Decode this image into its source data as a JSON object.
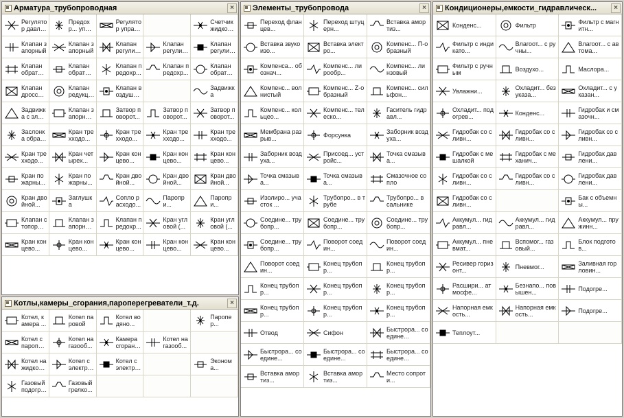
{
  "panels": {
    "armature": {
      "title": "Арматура_трубопроводная",
      "items": [
        "Регулятор давления",
        "Предохр... управл...",
        "Регулятор управл...",
        "",
        "Счетчик жидкост...",
        "Клапан запорный",
        "Клапан запорный",
        "Клапан регулир...",
        "Клапан регулир...",
        "Клапан регулир...",
        "Клапан обратны...",
        "Клапан обратны...",
        "Клапан предохр...",
        "Клапан предохр...",
        "Клапан обратны...",
        "Клапан дроссел...",
        "Клапан редукци...",
        "Клапан воздушн...",
        "",
        "Задвижка",
        "Задвижка с электро...",
        "Клапан запорны...",
        "Затвор поворот...",
        "Затвор поворот...",
        "Затвор поворот...",
        "Заслонка обратны...",
        "Кран трехходо...",
        "Кран трехходо...",
        "Кран трехходо...",
        "Кран трехходо...",
        "Кран трехходо...",
        "Кран четырех...",
        "Кран концево...",
        "Кран концево...",
        "Кран концево...",
        "Кран пожарны...",
        "Кран пожарны...",
        "Кран двойной...",
        "Кран двойной...",
        "Кран двойной...",
        "Кран двойной...",
        "Заглушка",
        "Сопло расходо...",
        "Паропри...",
        "Паропри...",
        "Клапан стопорный",
        "Клапан запорны...",
        "Клапан предохр...",
        "Кран угловой (...",
        "Кран угловой (...",
        "Кран концево...",
        "Кран концево...",
        "Кран концево...",
        "Кран концево...",
        "Кран концево..."
      ]
    },
    "boilers": {
      "title": "Котлы,камеры_сгорания,пароперегреватели_т.д.",
      "items": [
        "Котел, камера ...",
        "Котел паровой",
        "Котел водяно...",
        "",
        "Паропер...",
        "Котел с паропер...",
        "Котел на газооб...",
        "Камера сгорани...",
        "Котел на газооб...",
        "",
        "Котел на жидком...",
        "Котел с электро...",
        "Котел с электро...",
        "",
        "Эконома...",
        "Газовый подогре...",
        "Газовый грелко...",
        "",
        "",
        ""
      ]
    },
    "pipe": {
      "title": "Элементы_трубопровода",
      "items": [
        "Переход фланцев...",
        "Переход штуцерн...",
        "Вставка амортиз...",
        "Вставка звукоизо...",
        "Вставка электро...",
        "Компенс... П-образный",
        "Компенса... обознач...",
        "Компенс... лирообр...",
        "Компенс... линзовый",
        "Компенс... волнистый",
        "Компенс... Z-образный",
        "Компенс... сильфон...",
        "Компенс... кольцео...",
        "Компенс... телеско...",
        "Гаситель гидравл...",
        "Мембрана разрыв...",
        "Форсунка",
        "Заборник воздуха...",
        "Заборник воздуха...",
        "Присоед... устройс...",
        "Точка смазыва...",
        "Точка смазыва...",
        "Точка смазыва...",
        "Смазочное сопло",
        "Изолиро... участок ...",
        "Трубопро... в трубе",
        "Трубопро... в сальнике",
        "Соедине... трубопр...",
        "Соедине... трубопр...",
        "Соедине... трубопр...",
        "Соедине... трубопр...",
        "Поворот соедин...",
        "Поворот соедин...",
        "Поворот соедин...",
        "Конец трубопр...",
        "Конец трубопр...",
        "Конец трубопр...",
        "Конец трубопр...",
        "Конец трубопр...",
        "Конец трубопр...",
        "Конец трубопр...",
        "Конец трубопр...",
        "Отвод",
        "Сифон",
        "Быстрора... соедине...",
        "Быстрора... соедине...",
        "Быстрора... соедине...",
        "Быстрора... соедине...",
        "Вставка амортиз...",
        "Вставка амортиз...",
        "Место сопроти..."
      ]
    },
    "cond": {
      "title": "Кондиционеры,емкости_гидравлическ...",
      "items": [
        "Конденс...",
        "Фильтр",
        "Фильтр с магнитн...",
        "Фильтр с индикато...",
        "Влагоот... с ручны...",
        "Влагоот... с автома...",
        "Фильтр с ручным",
        "Воздухо...",
        "Маслора...",
        "Увлажни...",
        "Охладит... без указа...",
        "Охладит... с указан...",
        "Охладит... подогрев...",
        "Конденс...",
        "Гидробак и смазочн...",
        "Гидробак со сливн...",
        "Гидробак со сливн...",
        "Гидробак со сливн...",
        "Гидробак с мешалкой",
        "Гидробак с механич...",
        "Гидробак давлени...",
        "Гидробак со сливн...",
        "Гидробак со сливн...",
        "Гидробак давлени...",
        "Гидробак со сливн...",
        "",
        "Бак с объемны...",
        "Аккумул... гидравл...",
        "Аккумул... гидравл...",
        "Аккумул... пружинн...",
        "Аккумул... пневмат...",
        "Вспомог... газовый...",
        "Блок подготов...",
        "Ресивер горизонт...",
        "Пневмог...",
        "Заливная горловин...",
        "Расшири... атмосфе...",
        "Безнапо... повышен...",
        "Подогре...",
        "Напорная емкость...",
        "Напорная емкость...",
        "Подогре...",
        "Теплоут...",
        "",
        ""
      ]
    }
  }
}
